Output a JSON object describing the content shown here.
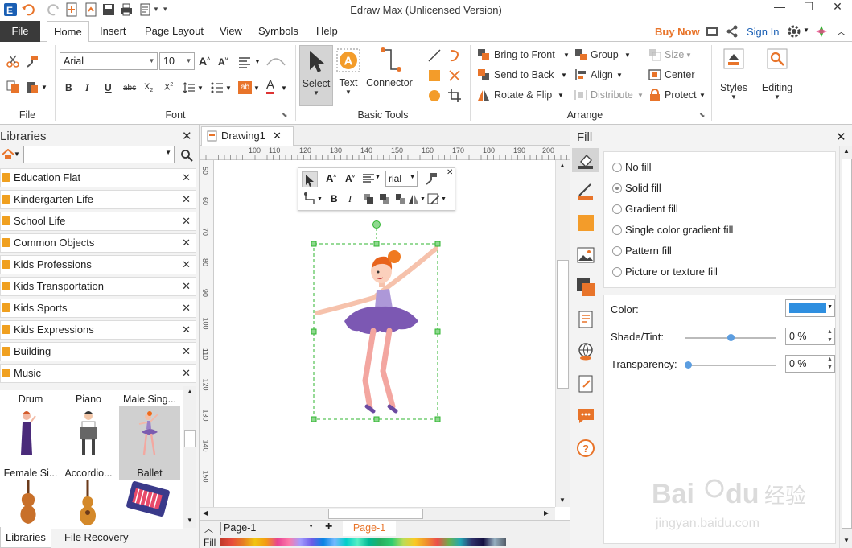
{
  "app": {
    "title": "Edraw Max (Unlicensed Version)"
  },
  "menu": {
    "file": "File",
    "tabs": [
      "Home",
      "Insert",
      "Page Layout",
      "View",
      "Symbols",
      "Help"
    ],
    "buy_now": "Buy Now",
    "sign_in": "Sign In"
  },
  "ribbon": {
    "groups": {
      "file": "File",
      "font": "Font",
      "basic_tools": "Basic Tools",
      "arrange": "Arrange"
    },
    "font_name": "Arial",
    "font_size": "10",
    "select": "Select",
    "text": "Text",
    "connector": "Connector",
    "bring_to_front": "Bring to Front",
    "send_to_back": "Send to Back",
    "rotate_flip": "Rotate & Flip",
    "group": "Group",
    "align": "Align",
    "distribute": "Distribute",
    "size": "Size",
    "center": "Center",
    "protect": "Protect",
    "styles": "Styles",
    "editing": "Editing"
  },
  "libraries": {
    "title": "Libraries",
    "items": [
      "Education Flat",
      "Kindergarten Life",
      "School Life",
      "Common Objects",
      "Kids Professions",
      "Kids Transportation",
      "Kids Sports",
      "Kids Expressions",
      "Building",
      "Music"
    ],
    "shapes": [
      "Drum",
      "Piano",
      "Male Sing...",
      "Female Si...",
      "Accordio...",
      "Ballet"
    ],
    "bottom_tabs": [
      "Libraries",
      "File Recovery"
    ]
  },
  "document": {
    "tab": "Drawing1",
    "ruler_h": [
      "100",
      "110",
      "120",
      "130",
      "140",
      "150",
      "160",
      "170",
      "180",
      "190",
      "200"
    ],
    "ruler_v": [
      "50",
      "60",
      "70",
      "80",
      "90",
      "100",
      "110",
      "120",
      "130",
      "140",
      "150"
    ],
    "floating_font": "rial",
    "page_select": "Page-1",
    "page_tab": "Page-1",
    "fill_label": "Fill"
  },
  "fill_panel": {
    "title": "Fill",
    "options": [
      "No fill",
      "Solid fill",
      "Gradient fill",
      "Single color gradient fill",
      "Pattern fill",
      "Picture or texture fill"
    ],
    "selected_option": "Solid fill",
    "color_label": "Color:",
    "color_value": "#2f8fe0",
    "shade_label": "Shade/Tint:",
    "shade_value": "0 %",
    "shade_level": 0.5,
    "transparency_label": "Transparency:",
    "transparency_value": "0 %",
    "transparency_level": 0.0
  },
  "watermark": {
    "logo": "Baidu经验",
    "url": "jingyan.baidu.com"
  },
  "colors": {
    "accent": "#e8742a",
    "link": "#1a5fb4",
    "file_tab": "#3a3a3a",
    "selection": "#2fb52f"
  }
}
